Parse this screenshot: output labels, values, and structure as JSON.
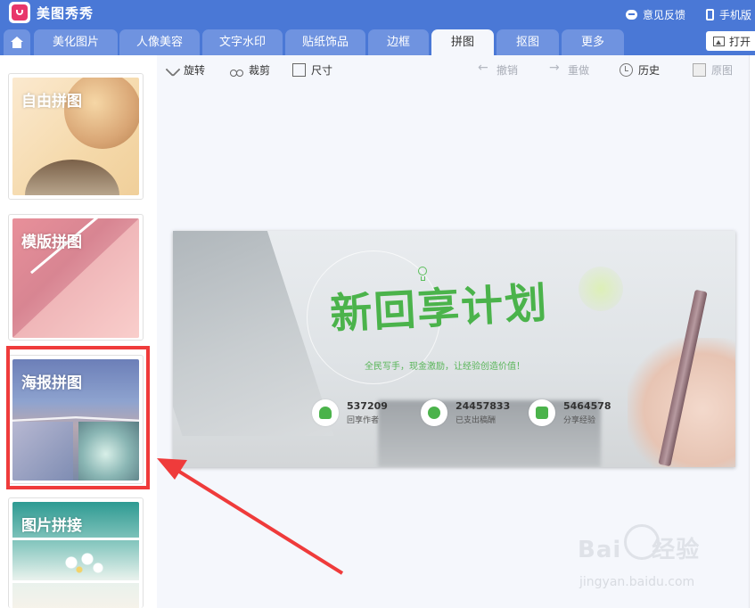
{
  "app": {
    "title": "美图秀秀",
    "feedback_label": "意见反馈",
    "mobile_label": "手机版"
  },
  "tabs": [
    {
      "label": "美化图片"
    },
    {
      "label": "人像美容"
    },
    {
      "label": "文字水印"
    },
    {
      "label": "贴纸饰品"
    },
    {
      "label": "边框"
    },
    {
      "label": "拼图",
      "active": true
    },
    {
      "label": "抠图"
    },
    {
      "label": "更多"
    }
  ],
  "open_button": "打开",
  "sidebar": {
    "items": [
      {
        "label": "自由拼图"
      },
      {
        "label": "模版拼图"
      },
      {
        "label": "海报拼图",
        "highlighted": true
      },
      {
        "label": "图片拼接"
      }
    ]
  },
  "toolbar": {
    "rotate": "旋转",
    "crop": "裁剪",
    "size": "尺寸",
    "undo": "撤销",
    "redo": "重做",
    "history": "历史",
    "original": "原图"
  },
  "poster": {
    "title": "新回享计划",
    "subtitle": "全民写手，现金激励，让经验创造价值！",
    "stats": [
      {
        "value": "537209",
        "label": "回享作者"
      },
      {
        "value": "24457833",
        "label": "已支出稿酬"
      },
      {
        "value": "5464578",
        "label": "分享经验"
      }
    ]
  },
  "watermark": {
    "brand": "Bai",
    "brand_suffix": "经验",
    "url": "jingyan.baidu.com"
  },
  "colors": {
    "titlebar": "#4a78d6",
    "tab_inactive": "#6f93e0",
    "workspace": "#f5f7fc",
    "highlight": "#ef3b3b",
    "poster_green": "#4bb34b"
  }
}
